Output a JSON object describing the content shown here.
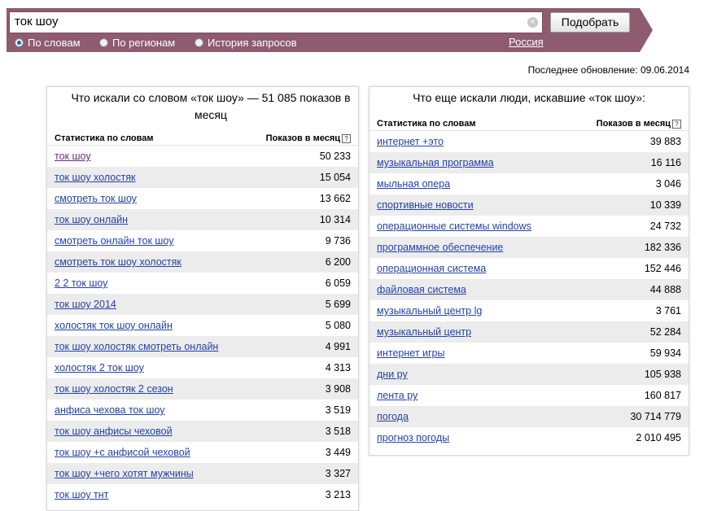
{
  "search": {
    "query": "ток шоу",
    "submit_label": "Подобрать",
    "modes": [
      {
        "label": "По словам",
        "checked": true
      },
      {
        "label": "По регионам",
        "checked": false
      },
      {
        "label": "История запросов",
        "checked": false
      }
    ],
    "region": "Россия"
  },
  "last_updated": "Последнее обновление: 09.06.2014",
  "left": {
    "title": "Что искали со словом «ток шоу» — 51 085 показов в месяц",
    "col_word": "Статистика по словам",
    "col_count": "Показов в месяц",
    "rows": [
      {
        "q": "ток шоу",
        "n": "50 233"
      },
      {
        "q": "ток шоу холостяк",
        "n": "15 054"
      },
      {
        "q": "смотреть ток шоу",
        "n": "13 662"
      },
      {
        "q": "ток шоу онлайн",
        "n": "10 314"
      },
      {
        "q": "смотреть онлайн ток шоу",
        "n": "9 736"
      },
      {
        "q": "смотреть ток шоу холостяк",
        "n": "6 200"
      },
      {
        "q": "2 2 ток шоу",
        "n": "6 059"
      },
      {
        "q": "ток шоу 2014",
        "n": "5 699"
      },
      {
        "q": "холостяк ток шоу онлайн",
        "n": "5 080"
      },
      {
        "q": "ток шоу холостяк смотреть онлайн",
        "n": "4 991"
      },
      {
        "q": "холостяк 2 ток шоу",
        "n": "4 313"
      },
      {
        "q": "ток шоу холостяк 2 сезон",
        "n": "3 908"
      },
      {
        "q": "анфиса чехова ток шоу",
        "n": "3 519"
      },
      {
        "q": "ток шоу анфисы чеховой",
        "n": "3 518"
      },
      {
        "q": "ток шоу +с анфисой чеховой",
        "n": "3 449"
      },
      {
        "q": "ток шоу +чего хотят мужчины",
        "n": "3 327"
      },
      {
        "q": "ток шоу тнт",
        "n": "3 213"
      }
    ]
  },
  "right": {
    "title": "Что еще искали люди, искавшие «ток шоу»:",
    "col_word": "Статистика по словам",
    "col_count": "Показов в месяц",
    "rows": [
      {
        "q": "интернет +это",
        "n": "39 883"
      },
      {
        "q": "музыкальная программа",
        "n": "16 116"
      },
      {
        "q": "мыльная опера",
        "n": "3 046"
      },
      {
        "q": "спортивные новости",
        "n": "10 339"
      },
      {
        "q": "операционные системы windows",
        "n": "24 732"
      },
      {
        "q": "программное обеспечение",
        "n": "182 336"
      },
      {
        "q": "операционная система",
        "n": "152 446"
      },
      {
        "q": "файловая система",
        "n": "44 888"
      },
      {
        "q": "музыкальный центр lg",
        "n": "3 761"
      },
      {
        "q": "музыкальный центр",
        "n": "52 284"
      },
      {
        "q": "интернет игры",
        "n": "59 934"
      },
      {
        "q": "дни ру",
        "n": "105 938"
      },
      {
        "q": "лента ру",
        "n": "160 817"
      },
      {
        "q": "погода",
        "n": "30 714 779"
      },
      {
        "q": "прогноз погоды",
        "n": "2 010 495"
      }
    ]
  }
}
